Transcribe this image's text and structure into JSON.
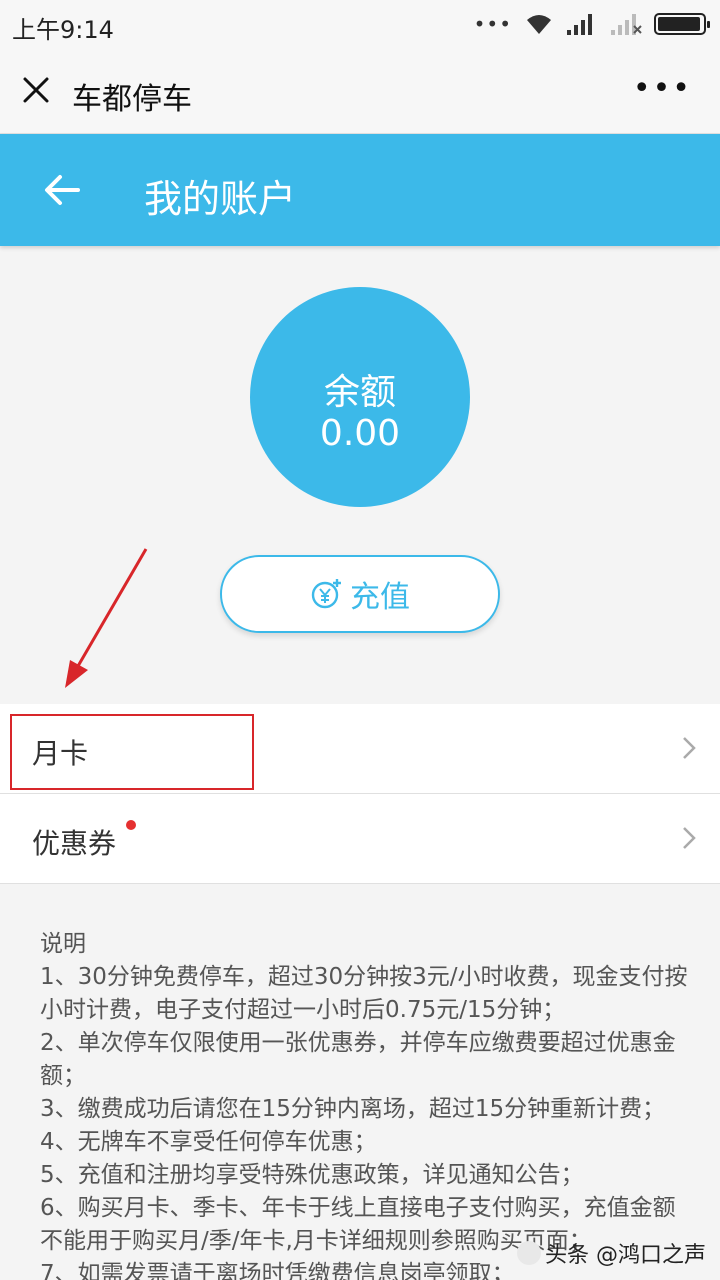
{
  "status_bar": {
    "time": "上午9:14",
    "dots": "•••",
    "battery_level": 0.95
  },
  "wechat_bar": {
    "title": "车都停车",
    "more": "•••"
  },
  "header": {
    "title": "我的账户"
  },
  "balance": {
    "label": "余额",
    "value": "0.00"
  },
  "recharge": {
    "label": "充值"
  },
  "menu": [
    {
      "label": "月卡",
      "highlighted": true
    },
    {
      "label": "优惠券",
      "has_badge": true
    }
  ],
  "notes": {
    "title": "说明",
    "lines": [
      "1、30分钟免费停车，超过30分钟按3元/小时收费，现金支付按小时计费，电子支付超过一小时后0.75元/15分钟；",
      "2、单次停车仅限使用一张优惠券，并停车应缴费要超过优惠金额；",
      "3、缴费成功后请您在15分钟内离场，超过15分钟重新计费；",
      "4、无牌车不享受任何停车优惠；",
      "5、充值和注册均享受特殊优惠政策，详见通知公告；",
      "6、购买月卡、季卡、年卡于线上直接电子支付购买，充值金额不能用于购买月/季/年卡,月卡详细规则参照购买页面；",
      "7、如需发票请于离场时凭缴费信息岗亭领取；"
    ]
  },
  "watermark": {
    "text": "头条 @鸿口之声"
  },
  "colors": {
    "accent": "#3cb9e9",
    "highlight": "#d8262a",
    "badge": "#e53030"
  }
}
